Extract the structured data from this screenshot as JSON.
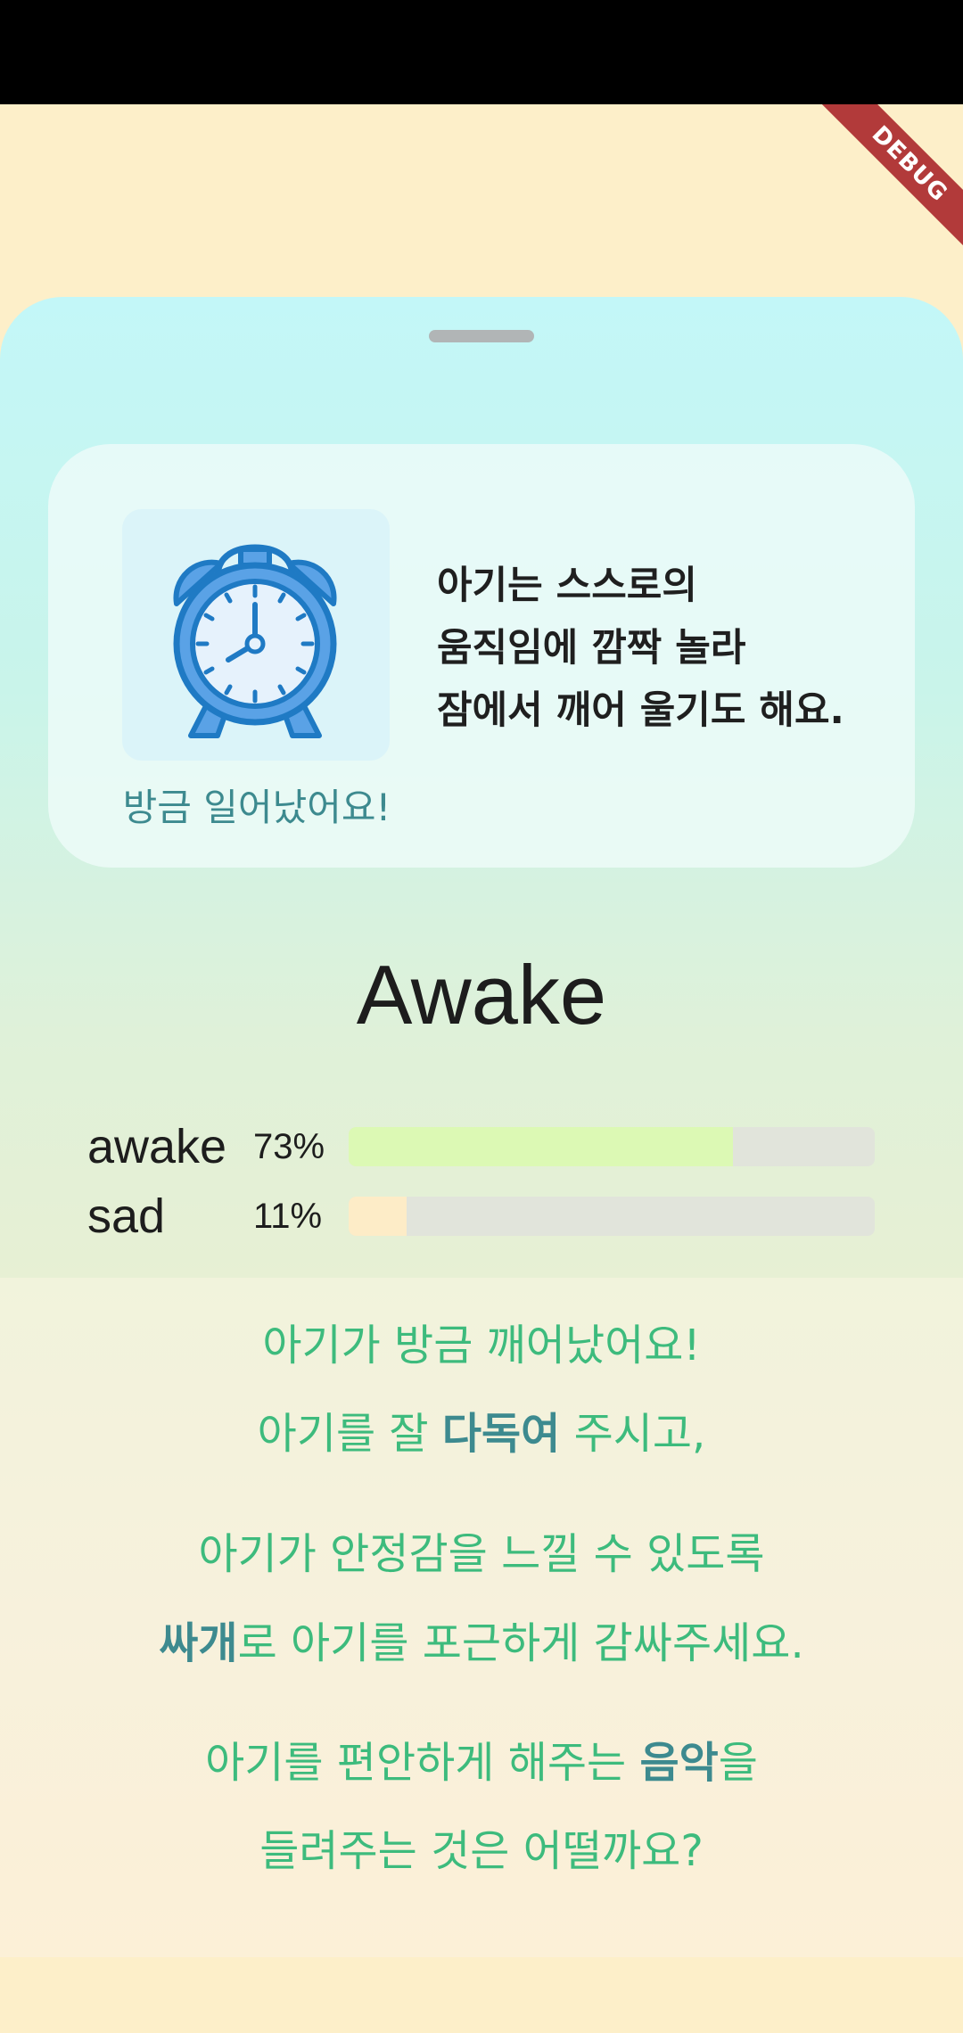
{
  "debug_banner": {
    "label": "DEBUG"
  },
  "card": {
    "caption": "방금 일어났어요!",
    "description_lines": [
      "아기는 스스로의",
      "움직임에 깜짝 놀라",
      "잠에서 깨어 울기도 해요."
    ],
    "icon": "alarm-clock-icon"
  },
  "state": {
    "title": "Awake"
  },
  "probabilities": [
    {
      "label": "awake",
      "percent": "73%",
      "value": 0.73,
      "color": "#dcf9b4"
    },
    {
      "label": "sad",
      "percent": "11%",
      "value": 0.11,
      "color": "#fdecc7"
    }
  ],
  "message": {
    "line1": "아기가 방금 깨어났어요!",
    "line2_pre": "아기를 잘 ",
    "line2_hl": "다독여",
    "line2_post": " 주시고,",
    "line3": "아기가 안정감을 느낄 수 있도록",
    "line4_hl": "싸개",
    "line4_post": "로 아기를 포근하게 감싸주세요.",
    "line5_pre": "아기를 편안하게 해주는 ",
    "line5_hl": "음악",
    "line5_post": "을",
    "line6": "들려주는 것은 어떨까요?"
  },
  "colors": {
    "accent_green": "#3dbb7d",
    "accent_teal": "#3d8a8f",
    "background": "#fdefc9"
  }
}
